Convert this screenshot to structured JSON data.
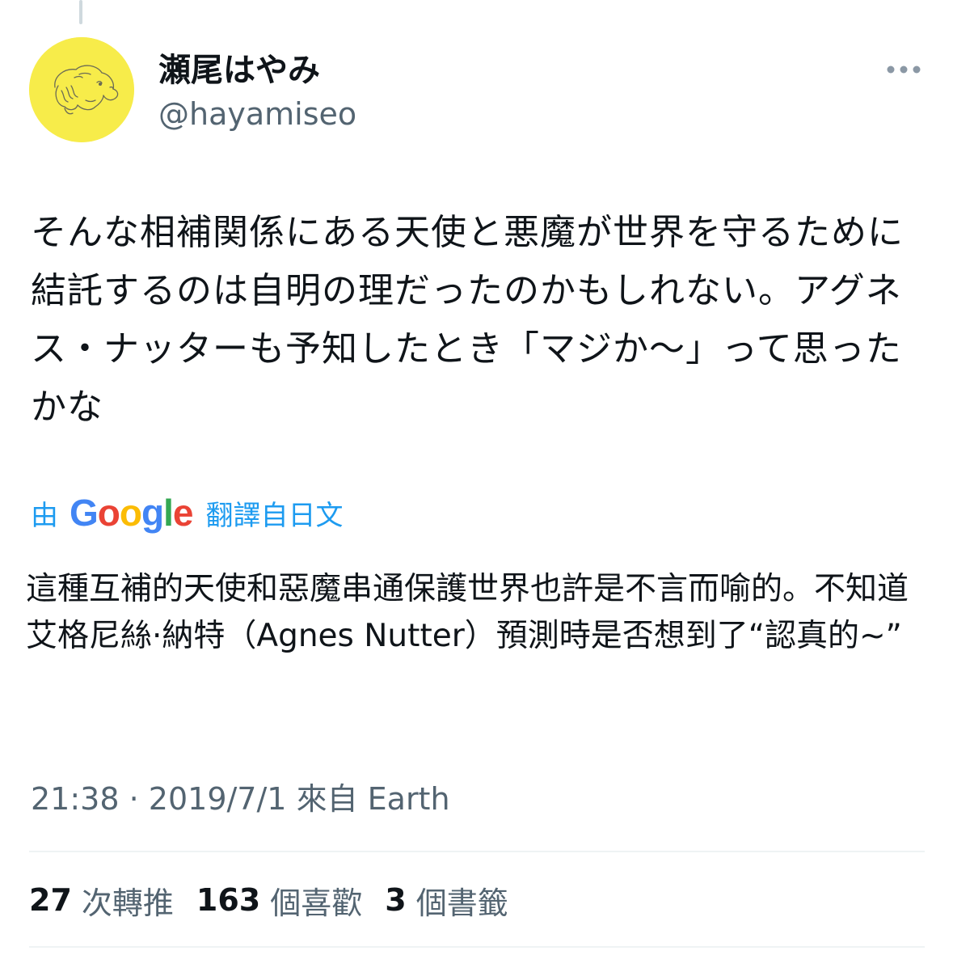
{
  "author": {
    "display_name": "瀬尾はやみ",
    "handle": "@hayamiseo",
    "avatar_color": "#f7ec4a"
  },
  "tweet": {
    "text": "そんな相補関係にある天使と悪魔が世界を守るために結託するのは自明の理だったのかもしれない。アグネス・ナッターも予知したとき「マジか〜」って思ったかな"
  },
  "translation": {
    "prefix": "由",
    "google_letters": [
      "G",
      "o",
      "o",
      "g",
      "l",
      "e"
    ],
    "suffix": "翻譯自日文",
    "text": "這種互補的天使和惡魔串通保護世界也許是不言而喻的。不知道艾格尼絲·納特（Agnes Nutter）預測時是否想到了“認真的~”"
  },
  "meta": {
    "time": "21:38",
    "separator": "·",
    "date": "2019/7/1",
    "source": "來自 Earth"
  },
  "stats": {
    "retweets": {
      "count": "27",
      "label": "次轉推"
    },
    "likes": {
      "count": "163",
      "label": "個喜歡"
    },
    "bookmarks": {
      "count": "3",
      "label": "個書籤"
    }
  },
  "icons": {
    "more": "more-dots-icon",
    "avatar": "dog-sketch-icon"
  },
  "colors": {
    "link": "#1d9bf0",
    "secondary_text": "#536471",
    "primary_text": "#0f1419",
    "divider": "#eff3f4"
  }
}
